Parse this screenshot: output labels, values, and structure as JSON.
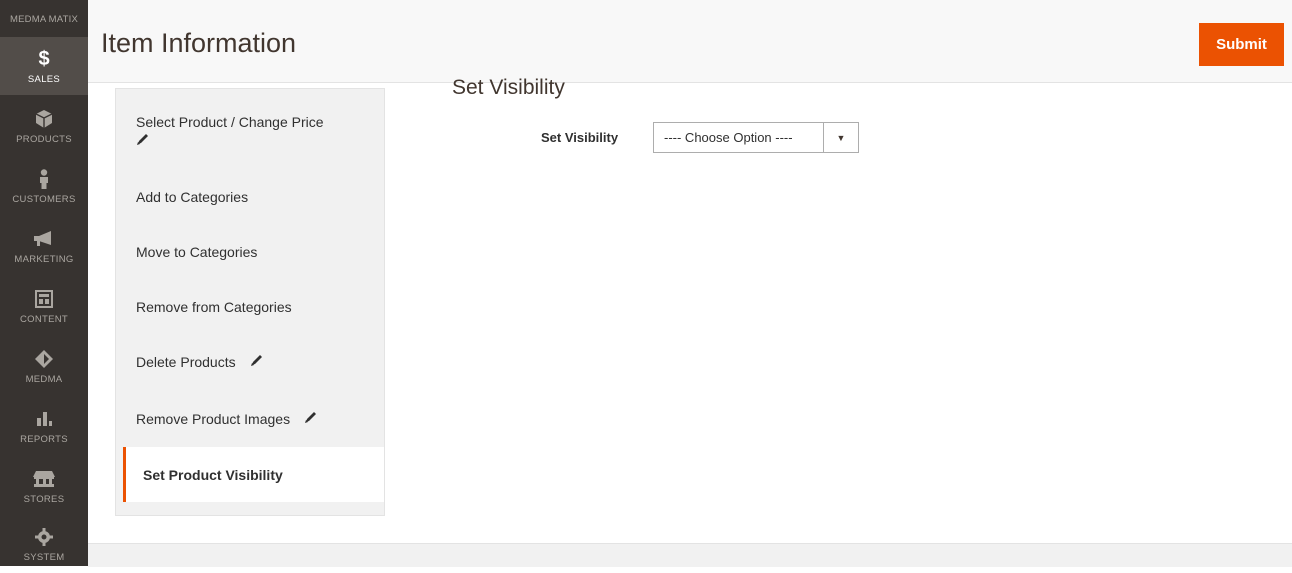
{
  "nav": {
    "logo_text": "MEDMA MATIX",
    "items": [
      {
        "label": "SALES",
        "icon": "dollar-icon"
      },
      {
        "label": "PRODUCTS",
        "icon": "cube-icon"
      },
      {
        "label": "CUSTOMERS",
        "icon": "person-icon"
      },
      {
        "label": "MARKETING",
        "icon": "megaphone-icon"
      },
      {
        "label": "CONTENT",
        "icon": "layout-icon"
      },
      {
        "label": "MEDMA",
        "icon": "diamond-icon"
      },
      {
        "label": "REPORTS",
        "icon": "bar-chart-icon"
      },
      {
        "label": "STORES",
        "icon": "store-icon"
      },
      {
        "label": "SYSTEM",
        "icon": "gear-icon"
      }
    ],
    "active": "SALES",
    "accent_color": "#eb5202"
  },
  "header": {
    "title": "Item Information",
    "submit_label": "Submit"
  },
  "tabs": {
    "items": [
      {
        "label": "Select Product / Change Price",
        "editable": true
      },
      {
        "label": "Add to Categories",
        "editable": false
      },
      {
        "label": "Move to Categories",
        "editable": false
      },
      {
        "label": "Remove from Categories",
        "editable": false
      },
      {
        "label": "Delete Products",
        "editable": true
      },
      {
        "label": "Remove Product Images",
        "editable": true
      },
      {
        "label": "Set Product Visibility",
        "editable": false
      }
    ],
    "active": "Set Product Visibility"
  },
  "main": {
    "section_title": "Set Visibility",
    "field_label": "Set Visibility",
    "select_value": "---- Choose Option ----"
  }
}
